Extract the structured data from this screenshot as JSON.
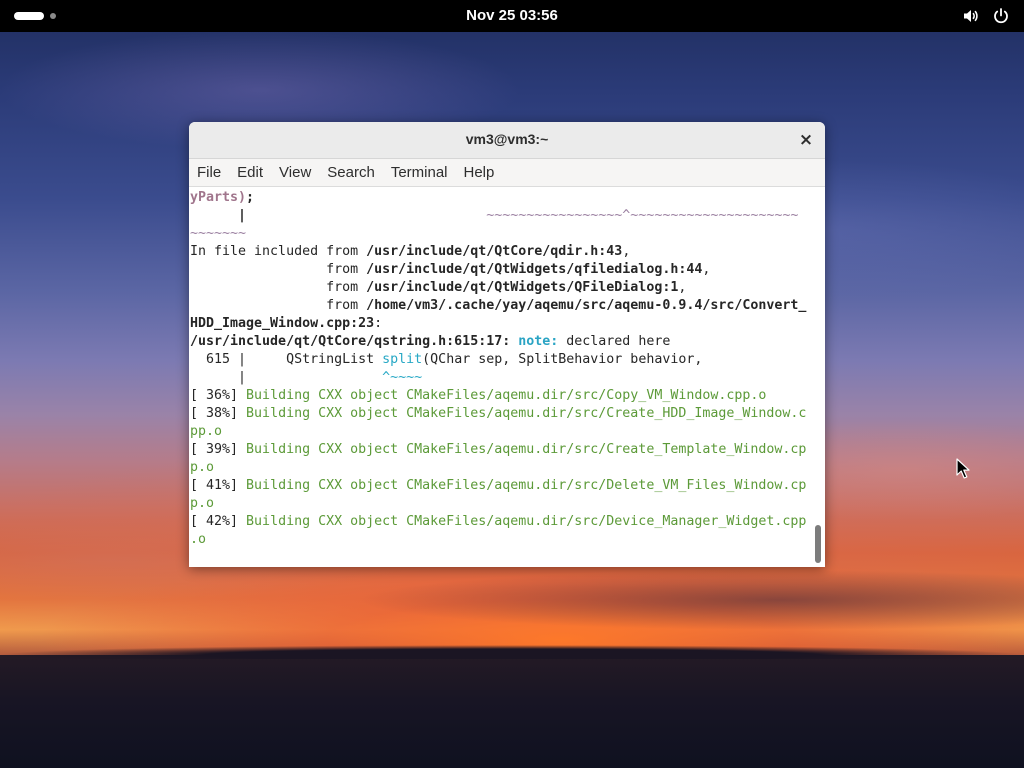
{
  "topbar": {
    "clock": "Nov 25  03:56",
    "icons": [
      "volume-icon",
      "power-icon"
    ]
  },
  "window": {
    "title": "vm3@vm3:~",
    "close_glyph": "×",
    "menu": [
      "File",
      "Edit",
      "View",
      "Search",
      "Terminal",
      "Help"
    ]
  },
  "terminal": {
    "lines": [
      [
        {
          "t": "yParts)",
          "c": "purple"
        },
        {
          "t": ";",
          "c": "b"
        }
      ],
      [
        {
          "t": "      |                              ",
          "c": "b"
        },
        {
          "t": "~~~~~~~~~~~~~~~~~^~~~~~~~~~~~~~~~~~~~~~",
          "c": "tilde"
        }
      ],
      [
        {
          "t": "~~~~~~~",
          "c": "tilde"
        }
      ],
      [
        {
          "t": "In file included from ",
          "c": ""
        },
        {
          "t": "/usr/include/qt/QtCore/qdir.h:43",
          "c": "b"
        },
        {
          "t": ",",
          "c": ""
        }
      ],
      [
        {
          "t": "                 from ",
          "c": ""
        },
        {
          "t": "/usr/include/qt/QtWidgets/qfiledialog.h:44",
          "c": "b"
        },
        {
          "t": ",",
          "c": ""
        }
      ],
      [
        {
          "t": "                 from ",
          "c": ""
        },
        {
          "t": "/usr/include/qt/QtWidgets/QFileDialog:1",
          "c": "b"
        },
        {
          "t": ",",
          "c": ""
        }
      ],
      [
        {
          "t": "                 from ",
          "c": ""
        },
        {
          "t": "/home/vm3/.cache/yay/aqemu/src/aqemu-0.9.4/src/Convert_",
          "c": "b"
        }
      ],
      [
        {
          "t": "HDD_Image_Window.cpp:23",
          "c": "b"
        },
        {
          "t": ":",
          "c": ""
        }
      ],
      [
        {
          "t": "/usr/include/qt/QtCore/qstring.h:615:17:",
          "c": "b"
        },
        {
          "t": " ",
          "c": ""
        },
        {
          "t": "note:",
          "c": "cyan"
        },
        {
          "t": " declared here",
          "c": ""
        }
      ],
      [
        {
          "t": "  615 |     QStringList ",
          "c": ""
        },
        {
          "t": "split",
          "c": "cyan2"
        },
        {
          "t": "(QChar sep, SplitBehavior behavior,",
          "c": ""
        }
      ],
      [
        {
          "t": "      |                 ",
          "c": ""
        },
        {
          "t": "^~~~~",
          "c": "cyan2"
        }
      ],
      [
        {
          "t": "[ 36%] ",
          "c": ""
        },
        {
          "t": "Building CXX object CMakeFiles/aqemu.dir/src/Copy_VM_Window.cpp.o",
          "c": "green"
        }
      ],
      [
        {
          "t": "[ 38%] ",
          "c": ""
        },
        {
          "t": "Building CXX object CMakeFiles/aqemu.dir/src/Create_HDD_Image_Window.c",
          "c": "green"
        }
      ],
      [
        {
          "t": "pp.o",
          "c": "green"
        }
      ],
      [
        {
          "t": "[ 39%] ",
          "c": ""
        },
        {
          "t": "Building CXX object CMakeFiles/aqemu.dir/src/Create_Template_Window.cp",
          "c": "green"
        }
      ],
      [
        {
          "t": "p.o",
          "c": "green"
        }
      ],
      [
        {
          "t": "[ 41%] ",
          "c": ""
        },
        {
          "t": "Building CXX object CMakeFiles/aqemu.dir/src/Delete_VM_Files_Window.cp",
          "c": "green"
        }
      ],
      [
        {
          "t": "p.o",
          "c": "green"
        }
      ],
      [
        {
          "t": "[ 42%] ",
          "c": ""
        },
        {
          "t": "Building CXX object CMakeFiles/aqemu.dir/src/Device_Manager_Widget.cpp",
          "c": "green"
        }
      ],
      [
        {
          "t": ".o",
          "c": "green"
        }
      ]
    ]
  }
}
